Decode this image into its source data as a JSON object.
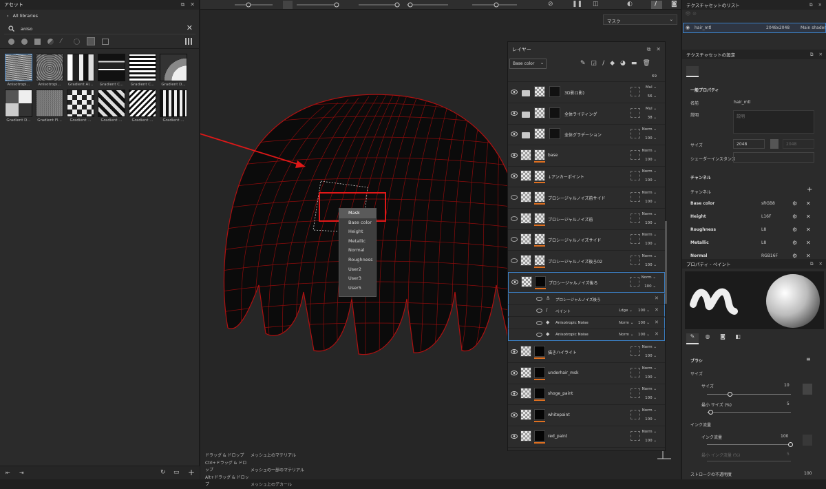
{
  "assets": {
    "title": "アセット",
    "breadcrumb": "All libraries",
    "search_value": "aniso",
    "thumbnails": [
      "Anisotropi...",
      "Anisotropi...",
      "Gradient Al...",
      "Gradient C...",
      "Gradient C...",
      "Gradient D...",
      "Gradient D...",
      "Gradient Fl...",
      "Gradient ...",
      "Gradient ...",
      "Gradient ...",
      "Gradient ..."
    ]
  },
  "viewport": {
    "mask_dropdown": "マスク",
    "hints": [
      {
        "keys": "ドラッグ & ドロップ",
        "action": "メッシュ上のマテリアル"
      },
      {
        "keys": "Ctrl+ドラッグ & ドロップ",
        "action": "メッシュの一部のマテリアル"
      },
      {
        "keys": "Alt+ドラッグ & ドロップ",
        "action": "メッシュ上のデカール"
      }
    ]
  },
  "context_menu": [
    "Mask",
    "Base color",
    "Height",
    "Metallic",
    "Normal",
    "Roughness",
    "User2",
    "User3",
    "User5"
  ],
  "layers": {
    "title": "レイヤー",
    "channel": "Base color",
    "top_partial": {
      "opacity": "69"
    },
    "rows": [
      {
        "name": "3D影(1影)",
        "blend": "Mul",
        "opacity": "56",
        "folder": true,
        "visible": true
      },
      {
        "name": "全体ライティング",
        "blend": "Mul",
        "opacity": "38",
        "folder": true,
        "visible": true
      },
      {
        "name": "全体グラデーション",
        "blend": "Norm",
        "opacity": "100",
        "folder": true,
        "visible": true
      },
      {
        "name": "base",
        "blend": "Norm",
        "opacity": "100",
        "folder": false,
        "visible": true
      },
      {
        "name": "↓アンカーポイント",
        "blend": "Norm",
        "opacity": "100",
        "folder": false,
        "visible": true
      },
      {
        "name": "プロシージャルノイズ前サイド",
        "blend": "Norm",
        "opacity": "100",
        "folder": false,
        "visible": false
      },
      {
        "name": "プロシージャルノイズ前",
        "blend": "Norm",
        "opacity": "100",
        "folder": false,
        "visible": false
      },
      {
        "name": "プロシージャルノイズサイド",
        "blend": "Norm",
        "opacity": "100",
        "folder": false,
        "visible": false
      },
      {
        "name": "プロシージャルノイズ後ろ02",
        "blend": "Norm",
        "opacity": "100",
        "folder": false,
        "visible": false
      },
      {
        "name": "プロシージャルノイズ後ろ",
        "blend": "Norm",
        "opacity": "100",
        "folder": false,
        "visible": true
      }
    ],
    "subrows": [
      {
        "name": "プロシージャルノイズ後ろ",
        "blend": "",
        "opacity": ""
      },
      {
        "name": "ペイント",
        "blend": "Ldge",
        "opacity": "100"
      },
      {
        "name": "Anisotropic Noise",
        "blend": "Norm",
        "opacity": "100"
      },
      {
        "name": "Anisotropic Noise",
        "blend": "Norm",
        "opacity": "100"
      }
    ],
    "rows2": [
      {
        "name": "描きハイライト",
        "blend": "Norm",
        "opacity": "100"
      },
      {
        "name": "underhair_msk",
        "blend": "Norm",
        "opacity": "100"
      },
      {
        "name": "shoge_paint",
        "blend": "Norm",
        "opacity": "100"
      },
      {
        "name": "whitepaint",
        "blend": "Norm",
        "opacity": "100"
      },
      {
        "name": "red_paint",
        "blend": "Norm",
        "opacity": "100"
      }
    ]
  },
  "texture_set_list": {
    "title": "テクスチャセットのリスト",
    "name": "hair_mtl",
    "size": "2048x2048",
    "shader": "Main shader"
  },
  "texture_set_settings": {
    "title": "テクスチャセットの設定",
    "section": "一般プロパティ",
    "name_label": "名前",
    "name_value": "hair_mtl",
    "desc_label": "説明",
    "desc_placeholder": "説明",
    "size_label": "サイズ",
    "size_value": "2048",
    "size_value2": "2048",
    "shader_label": "シェーダーインスタンス",
    "channels_title": "チャンネル",
    "channels_label": "チャンネル",
    "channels": [
      {
        "name": "Base color",
        "format": "sRGB8"
      },
      {
        "name": "Height",
        "format": "L16F"
      },
      {
        "name": "Roughness",
        "format": "L8"
      },
      {
        "name": "Metallic",
        "format": "L8"
      },
      {
        "name": "Normal",
        "format": "RGB16F"
      }
    ]
  },
  "paint_props": {
    "title": "プロパティ - ペイント",
    "brush_title": "ブラシ",
    "size_section": "サイズ",
    "size_label": "サイズ",
    "size_value": "10",
    "min_size_label": "最小 サイズ (%)",
    "min_size_value": "5",
    "flow_section": "インク流量",
    "flow_label": "インク流量",
    "flow_value": "100",
    "min_flow_label": "最小 インク流量 (%)",
    "min_flow_value": "5",
    "stroke_label": "ストロークの不透明度",
    "stroke_value": "100"
  }
}
